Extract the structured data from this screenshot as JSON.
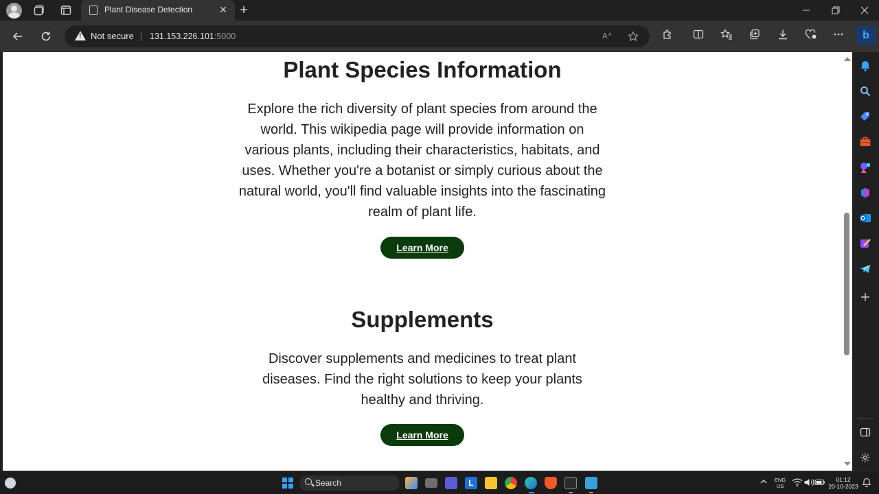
{
  "browser": {
    "tab_title": "Plant Disease Detection",
    "tab_close": "✕",
    "new_tab": "+",
    "security_label": "Not secure",
    "url_host": "131.153.226.101",
    "url_port": ":5000"
  },
  "page": {
    "sections": [
      {
        "heading": "Plant Species Information",
        "body": "Explore the rich diversity of plant species from around the world. This wikipedia page will provide information on various plants, including their characteristics, habitats, and uses. Whether you're a botanist or simply curious about the natural world, you'll find valuable insights into the fascinating realm of plant life.",
        "button": "Learn More"
      },
      {
        "heading": "Supplements",
        "body": "Discover supplements and medicines to treat plant diseases. Find the right solutions to keep your plants healthy and thriving.",
        "button": "Learn More"
      }
    ]
  },
  "taskbar": {
    "search_label": "Search",
    "lang_line1": "ENG",
    "lang_line2": "US",
    "time": "01:12",
    "date": "20-10-2023"
  },
  "colors": {
    "button_bg": "#0b3a0b",
    "heading": "#222222",
    "chrome_dark": "#202020",
    "chrome_mid": "#333333",
    "accent_blue": "#3aa0ff"
  }
}
